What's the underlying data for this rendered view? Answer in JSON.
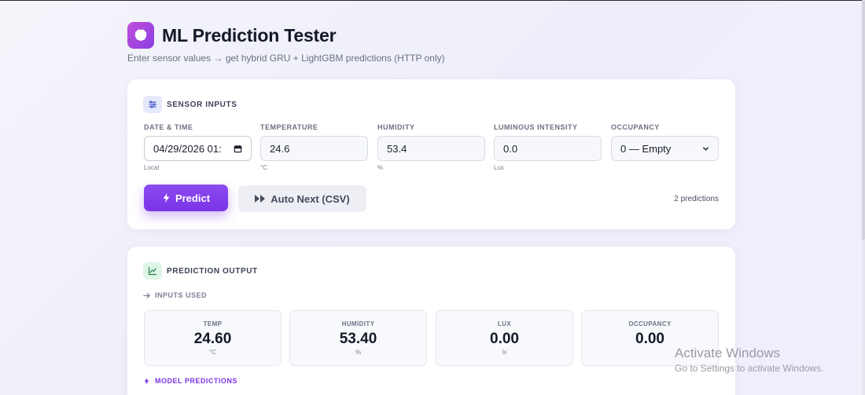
{
  "app": {
    "title": "ML Prediction Tester",
    "subtitle": "Enter sensor values → get hybrid GRU + LightGBM predictions (HTTP only)",
    "logo_icon": "brain-icon",
    "accent_color": "#7a34e6"
  },
  "sensor_inputs": {
    "section_title": "SENSOR INPUTS",
    "icon": "sliders-icon",
    "fields": {
      "datetime": {
        "label": "DATE & TIME",
        "value": "04/29/2026 01:",
        "hint": "Local"
      },
      "temperature": {
        "label": "TEMPERATURE",
        "value": "24.6",
        "hint": "°C"
      },
      "humidity": {
        "label": "HUMIDITY",
        "value": "53.4",
        "hint": "%"
      },
      "lux": {
        "label": "LUMINOUS INTENSITY",
        "value": "0.0",
        "hint": "Lux"
      },
      "occupancy": {
        "label": "OCCUPANCY",
        "value": "0 — Empty"
      }
    },
    "predict_label": "Predict",
    "auto_next_label": "Auto Next (CSV)",
    "prediction_count": "2 predictions"
  },
  "prediction_output": {
    "section_title": "PREDICTION OUTPUT",
    "icon": "line-chart-icon",
    "inputs_used_label": "INPUTS USED",
    "metrics": [
      {
        "label": "TEMP",
        "value": "24.60",
        "unit": "°C"
      },
      {
        "label": "HUMIDITY",
        "value": "53.40",
        "unit": "%"
      },
      {
        "label": "LUX",
        "value": "0.00",
        "unit": "lx"
      },
      {
        "label": "OCCUPANCY",
        "value": "0.00",
        "unit": ""
      }
    ],
    "model_predictions_label": "MODEL PREDICTIONS"
  },
  "watermark": {
    "line1": "Activate Windows",
    "line2": "Go to Settings to activate Windows."
  }
}
